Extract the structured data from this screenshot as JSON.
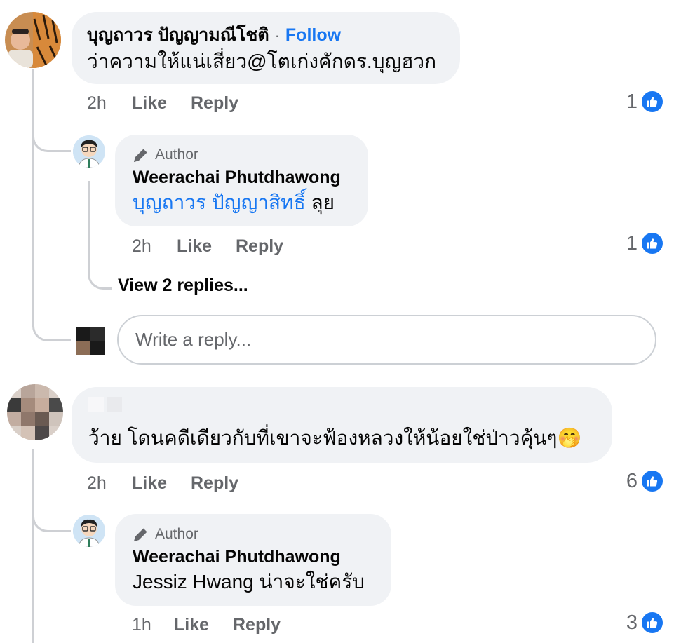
{
  "comment1": {
    "author": "บุญถาวร ปัญญามณีโชติ",
    "separator": "·",
    "follow_label": "Follow",
    "text": "ว่าความให้แน่เสี่ยว@โตเก่งคักดร.บุญฮวก",
    "time": "2h",
    "like_label": "Like",
    "reply_label": "Reply",
    "like_count": "1"
  },
  "reply1": {
    "badge": "Author",
    "author": "Weerachai Phutdhawong",
    "mention": "บุญถาวร ปัญญาสิทธิ์",
    "text": " ลุย",
    "time": "2h",
    "like_label": "Like",
    "reply_label": "Reply",
    "like_count": "1"
  },
  "view_replies_label": "View 2 replies...",
  "reply_input": {
    "placeholder": "Write a reply..."
  },
  "comment2": {
    "text": "ว้าย โดนคดีเดียวกับที่เขาจะฟ้องหลวงให้น้อยใช่ป่าวคุ้นๆ",
    "emoji": "🤭",
    "time": "2h",
    "like_label": "Like",
    "reply_label": "Reply",
    "like_count": "6"
  },
  "reply2": {
    "badge": "Author",
    "author": "Weerachai Phutdhawong",
    "text": "Jessiz Hwang น่าจะใช่ครับ",
    "time": "1h",
    "like_label": "Like",
    "reply_label": "Reply",
    "like_count": "3"
  },
  "colors": {
    "accent": "#1877f2",
    "bubble": "#f0f2f5",
    "muted": "#65676b",
    "thread_line": "#ced0d4"
  }
}
